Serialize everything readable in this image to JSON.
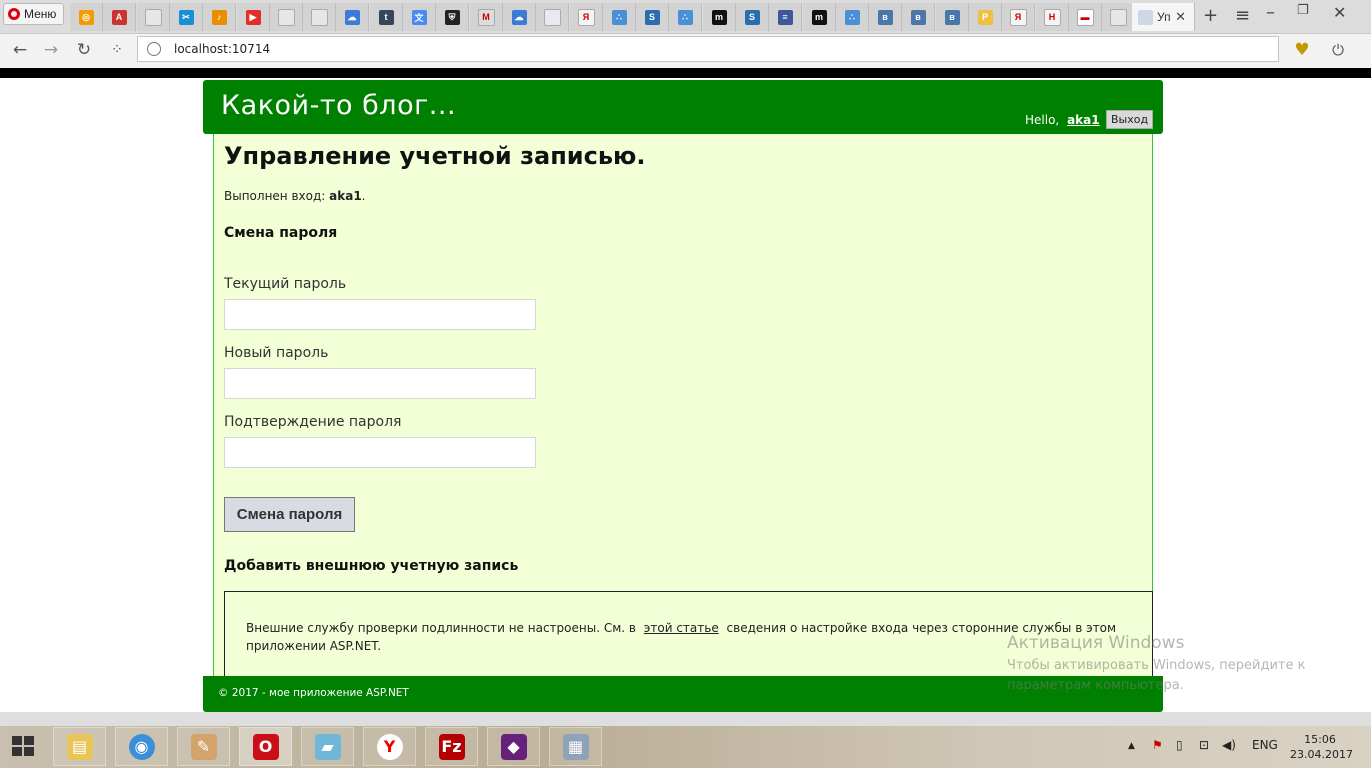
{
  "browser": {
    "menu_label": "Меню",
    "active_tab_label": "Уп",
    "url": "localhost:10714",
    "tab_favicons": [
      "opera-icon",
      "abp-icon",
      "page-icon",
      "scissors-icon",
      "music-icon",
      "youtube-icon",
      "page-icon",
      "page-icon",
      "cloud-icon",
      "tumblr-icon",
      "translate-icon",
      "shield-icon",
      "gmail-icon",
      "cloud-icon",
      "docs-icon",
      "yandex-icon",
      "dots-icon",
      "sql-icon",
      "dots-icon",
      "m-icon",
      "sql-icon",
      "stack-icon",
      "m-icon",
      "dots-icon",
      "vk-icon",
      "vk-icon",
      "vk-icon",
      "pma-icon",
      "yandex-icon",
      "h-icon",
      "flag-icon",
      "page-icon"
    ]
  },
  "header": {
    "site_title": "Какой-то блог...",
    "hello_label": "Hello,",
    "username": "aka1",
    "hello_suffix": "!",
    "logout_label": "Выход"
  },
  "main": {
    "title": "Управление учетной записью.",
    "logged_in_prefix": "Выполнен вход:",
    "logged_in_user": "aka1",
    "logged_in_suffix": ".",
    "change_password_heading": "Смена пароля",
    "current_password_label": "Текущий пароль",
    "new_password_label": "Новый пароль",
    "confirm_password_label": "Подтверждение пароля",
    "submit_label": "Смена пароля",
    "external_heading": "Добавить внешнюю учетную запись",
    "external_text_before": "Внешние службу проверки подлинности не настроены. См. в",
    "external_link": "этой статье",
    "external_text_after": "сведения о настройке входа через сторонние службы в этом приложении ASP.NET."
  },
  "footer": {
    "text": "© 2017 - мое приложение ASP.NET"
  },
  "watermark": {
    "title": "Активация Windows",
    "text": "Чтобы активировать Windows, перейдите к параметрам компьютера."
  },
  "taskbar": {
    "apps": [
      "file-explorer-icon",
      "chrome-icon",
      "paint-icon",
      "opera-icon",
      "notes-icon",
      "yandex-browser-icon",
      "filezilla-icon",
      "visual-studio-icon",
      "network-icon"
    ],
    "language": "ENG",
    "time": "15:06",
    "date": "23.04.2017"
  }
}
